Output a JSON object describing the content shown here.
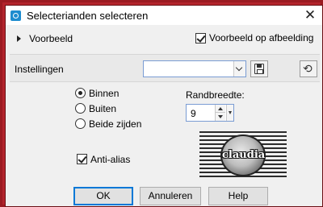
{
  "window": {
    "title": "Selecterianden selecteren",
    "close_glyph": "✕",
    "app_icon": "app-icon"
  },
  "preview": {
    "toggle_label": "Voorbeeld",
    "on_image_label": "Voorbeeld op afbeelding",
    "on_image_checked": true
  },
  "settings": {
    "label": "Instellingen",
    "preset_value": "",
    "save_icon": "floppy-disk-icon",
    "reset_icon": "reset-icon"
  },
  "side_options": {
    "items": [
      {
        "label": "Binnen",
        "selected": true
      },
      {
        "label": "Buiten",
        "selected": false
      },
      {
        "label": "Beide zijden",
        "selected": false
      }
    ]
  },
  "border_width": {
    "label": "Randbreedte:",
    "value": "9"
  },
  "antialias": {
    "label": "Anti-alias",
    "checked": true
  },
  "watermark": {
    "text": "claudia"
  },
  "buttons": {
    "ok": "OK",
    "cancel": "Annuleren",
    "help": "Help"
  }
}
